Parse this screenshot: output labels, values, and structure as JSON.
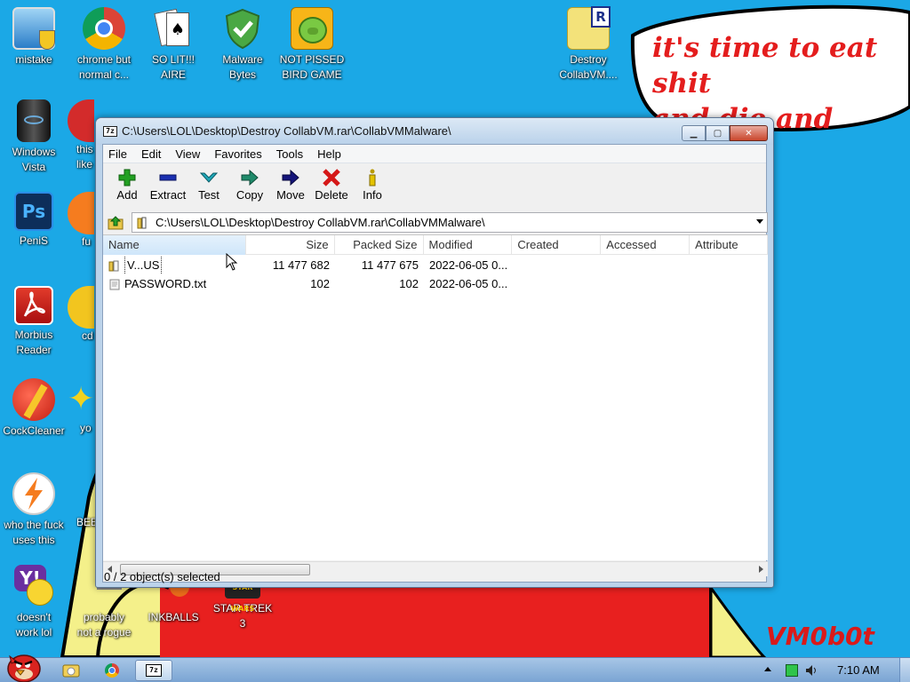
{
  "wallpaper": {
    "speech": "it's time to eat shit\nand die and chew\nbubble gum",
    "signature": "VM0b0t"
  },
  "desktop_icons": [
    {
      "label": "mistake",
      "icon": "monitor-shield-icon"
    },
    {
      "label": "chrome but\nnormal c...",
      "icon": "chrome-icon"
    },
    {
      "label": "SO LIT!!!\nAIRE",
      "icon": "solitaire-cards-icon"
    },
    {
      "label": "Malware\nBytes",
      "icon": "green-shield-icon"
    },
    {
      "label": "NOT PISSED\nBIRD GAME",
      "icon": "green-pig-icon"
    },
    {
      "label": "Destroy\nCollabVM....",
      "icon": "rar-archive-icon"
    },
    {
      "label": "Windows\nVista",
      "icon": "black-cylinder-icon"
    },
    {
      "label": "this\nlike",
      "icon": "opera-icon"
    },
    {
      "label": "PeniS",
      "icon": "photoshop-icon"
    },
    {
      "label": "fu",
      "icon": "orange-orb-icon"
    },
    {
      "label": "Morbius\nReader",
      "icon": "pdf-reader-icon"
    },
    {
      "label": "cd",
      "icon": "yellow-disc-icon"
    },
    {
      "label": "CockCleaner",
      "icon": "ccleaner-icon"
    },
    {
      "label": "yo",
      "icon": "yellow-star-icon"
    },
    {
      "label": "who the fuck\nuses this",
      "icon": "lightning-icon"
    },
    {
      "label": "BEE",
      "icon": "bee-icon"
    },
    {
      "label": "doesn't\nwork lol",
      "icon": "yahoo-messenger-icon"
    },
    {
      "label": "probably\nnot a rogue",
      "icon": "computer-icon"
    },
    {
      "label": "INKBALLS",
      "icon": "inkball-icon"
    },
    {
      "label": "STAR TREK\n3",
      "icon": "star-wars-icon"
    }
  ],
  "window": {
    "title": "C:\\Users\\LOL\\Desktop\\Destroy CollabVM.rar\\CollabVMMalware\\",
    "app_icon_text": "7z",
    "menu": [
      "File",
      "Edit",
      "View",
      "Favorites",
      "Tools",
      "Help"
    ],
    "toolbar": [
      {
        "label": "Add",
        "icon": "plus-icon",
        "color": "#22a022"
      },
      {
        "label": "Extract",
        "icon": "minus-icon",
        "color": "#1a2fb0"
      },
      {
        "label": "Test",
        "icon": "check-icon",
        "color": "#1fa7b8"
      },
      {
        "label": "Copy",
        "icon": "copy-arrow-icon",
        "color": "#1f8a6a"
      },
      {
        "label": "Move",
        "icon": "move-arrow-icon",
        "color": "#15157a"
      },
      {
        "label": "Delete",
        "icon": "delete-x-icon",
        "color": "#d51818"
      },
      {
        "label": "Info",
        "icon": "info-icon",
        "color": "#b89a00"
      }
    ],
    "address": "C:\\Users\\LOL\\Desktop\\Destroy CollabVM.rar\\CollabVMMalware\\",
    "columns": [
      "Name",
      "Size",
      "Packed Size",
      "Modified",
      "Created",
      "Accessed",
      "Attribute"
    ],
    "rows": [
      {
        "name": "V...US",
        "size": "11 477 682",
        "packed": "11 477 675",
        "modified": "2022-06-05 0...",
        "icon": "folder-icon"
      },
      {
        "name": "PASSWORD.txt",
        "size": "102",
        "packed": "102",
        "modified": "2022-06-05 0...",
        "icon": "text-file-icon"
      }
    ],
    "status": "0 / 2 object(s) selected"
  },
  "taskbar": {
    "clock": "7:10 AM",
    "buttons": [
      "angry-bird-start-icon",
      "explorer-folder-icon",
      "chrome-icon",
      "7zip-icon"
    ]
  },
  "colors": {
    "desktop": "#1ba8e6",
    "speech_text": "#e41d1d",
    "red_blob": "#e8201f",
    "yellow_blob": "#f4f08a"
  }
}
